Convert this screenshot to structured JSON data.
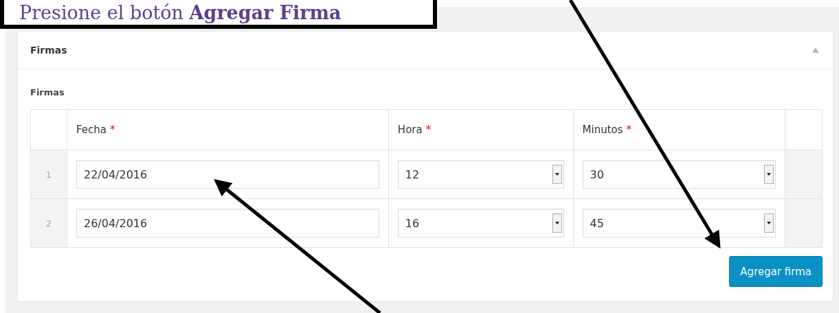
{
  "callout": {
    "text": "Presione el botón **Agregar Firma**"
  },
  "panel": {
    "title": "Firmas",
    "expanded": true
  },
  "field": {
    "label": "Firmas"
  },
  "table": {
    "columns": [
      {
        "label": "Fecha",
        "required_mark": "*",
        "kind": "text"
      },
      {
        "label": "Hora",
        "required_mark": "*",
        "kind": "select"
      },
      {
        "label": "Minutos",
        "required_mark": "*",
        "kind": "select"
      }
    ],
    "rows": [
      {
        "number": "1",
        "values": [
          "22/04/2016",
          "12",
          "30"
        ]
      },
      {
        "number": "2",
        "values": [
          "26/04/2016",
          "16",
          "45"
        ]
      }
    ]
  },
  "add_button": {
    "label": "Agregar firma"
  }
}
